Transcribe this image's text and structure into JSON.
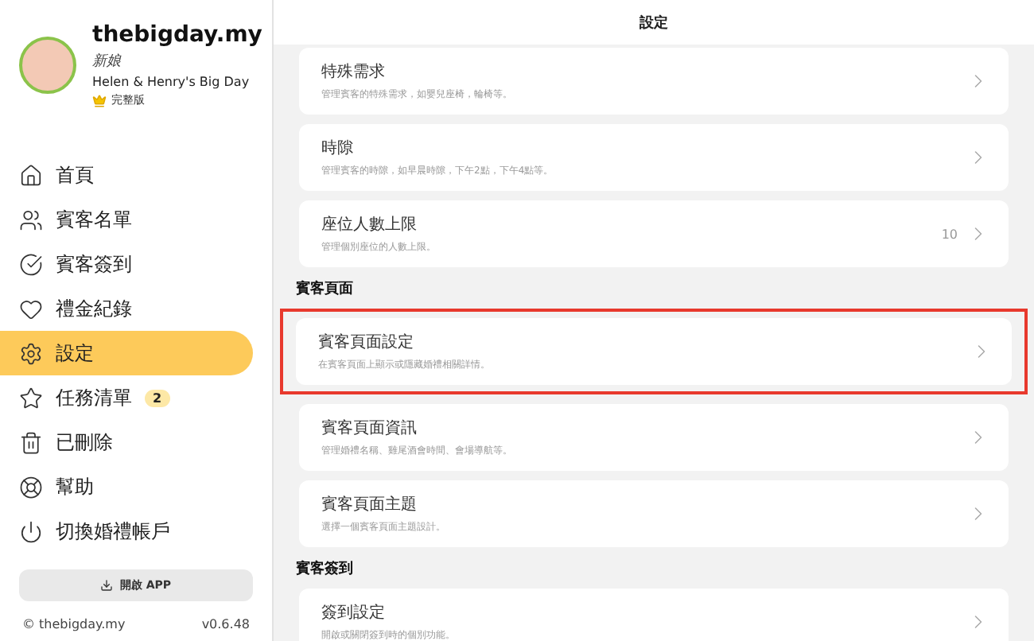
{
  "profile": {
    "name": "thebigday.my",
    "role": "新娘",
    "event": "Helen & Henry's Big Day",
    "plan": "完整版"
  },
  "nav": [
    {
      "label": "首頁",
      "selected": false
    },
    {
      "label": "賓客名單",
      "selected": false
    },
    {
      "label": "賓客簽到",
      "selected": false
    },
    {
      "label": "禮金紀錄",
      "selected": false
    },
    {
      "label": "設定",
      "selected": true
    },
    {
      "label": "任務清單",
      "selected": false,
      "badge": "2"
    },
    {
      "label": "已刪除",
      "selected": false
    },
    {
      "label": "幫助",
      "selected": false
    },
    {
      "label": "切換婚禮帳戶",
      "selected": false
    }
  ],
  "app_button": "開啟 APP",
  "footer": {
    "copyright": "© thebigday.my",
    "version": "v0.6.48"
  },
  "header": {
    "title": "設定"
  },
  "sections": [
    {
      "items": [
        {
          "title": "特殊需求",
          "description": "管理賓客的特殊需求，如嬰兒座椅，輪椅等。",
          "highlighted": false
        },
        {
          "title": "時隙",
          "description": "管理賓客的時隙，如早晨時隙，下午2點，下午4點等。",
          "highlighted": false
        },
        {
          "title": "座位人數上限",
          "description": "管理個別座位的人數上限。",
          "value": "10",
          "highlighted": false
        }
      ]
    },
    {
      "heading": "賓客頁面",
      "items": [
        {
          "title": "賓客頁面設定",
          "description": "在賓客頁面上顯示或隱藏婚禮相關詳情。",
          "highlighted": true
        },
        {
          "title": "賓客頁面資訊",
          "description": "管理婚禮名稱、雞尾酒會時間、會場導航等。",
          "highlighted": false
        },
        {
          "title": "賓客頁面主題",
          "description": "選擇一個賓客頁面主題設計。",
          "highlighted": false
        }
      ]
    },
    {
      "heading": "賓客簽到",
      "items": [
        {
          "title": "簽到設定",
          "description": "開啟或關閉簽到時的個別功能。",
          "highlighted": false
        }
      ]
    }
  ]
}
